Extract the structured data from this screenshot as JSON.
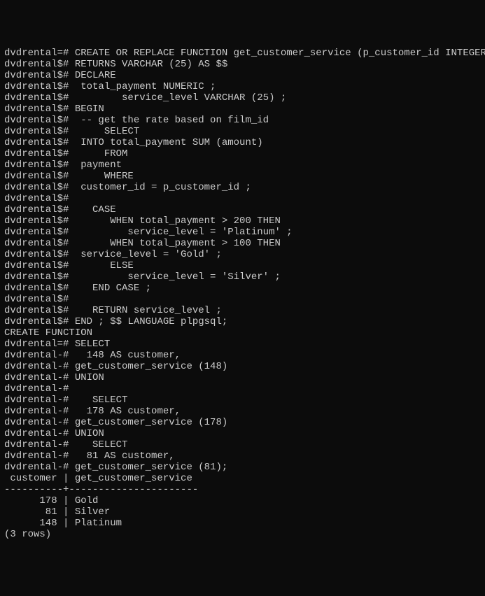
{
  "lines": [
    {
      "prompt": "dvdrental=#",
      "text": " CREATE OR REPLACE FUNCTION get_customer_service (p_customer_id INTEGER)"
    },
    {
      "prompt": "dvdrental$#",
      "text": " RETURNS VARCHAR (25) AS $$"
    },
    {
      "prompt": "dvdrental$#",
      "text": " DECLARE"
    },
    {
      "prompt": "dvdrental$#",
      "text": "  total_payment NUMERIC ;"
    },
    {
      "prompt": "dvdrental$#",
      "text": "         service_level VARCHAR (25) ;"
    },
    {
      "prompt": "dvdrental$#",
      "text": " BEGIN"
    },
    {
      "prompt": "dvdrental$#",
      "text": "  -- get the rate based on film_id"
    },
    {
      "prompt": "dvdrental$#",
      "text": "      SELECT"
    },
    {
      "prompt": "dvdrental$#",
      "text": "  INTO total_payment SUM (amount)"
    },
    {
      "prompt": "dvdrental$#",
      "text": "      FROM"
    },
    {
      "prompt": "dvdrental$#",
      "text": "  payment"
    },
    {
      "prompt": "dvdrental$#",
      "text": "      WHERE"
    },
    {
      "prompt": "dvdrental$#",
      "text": "  customer_id = p_customer_id ;"
    },
    {
      "prompt": "dvdrental$#",
      "text": ""
    },
    {
      "prompt": "dvdrental$#",
      "text": "    CASE"
    },
    {
      "prompt": "dvdrental$#",
      "text": "       WHEN total_payment > 200 THEN"
    },
    {
      "prompt": "dvdrental$#",
      "text": "          service_level = 'Platinum' ;"
    },
    {
      "prompt": "dvdrental$#",
      "text": "       WHEN total_payment > 100 THEN"
    },
    {
      "prompt": "dvdrental$#",
      "text": "  service_level = 'Gold' ;"
    },
    {
      "prompt": "dvdrental$#",
      "text": "       ELSE"
    },
    {
      "prompt": "dvdrental$#",
      "text": "          service_level = 'Silver' ;"
    },
    {
      "prompt": "dvdrental$#",
      "text": "    END CASE ;"
    },
    {
      "prompt": "dvdrental$#",
      "text": ""
    },
    {
      "prompt": "dvdrental$#",
      "text": "    RETURN service_level ;"
    },
    {
      "prompt": "dvdrental$#",
      "text": " END ; $$ LANGUAGE plpgsql;"
    },
    {
      "prompt": "",
      "text": "CREATE FUNCTION"
    },
    {
      "prompt": "dvdrental=#",
      "text": " SELECT"
    },
    {
      "prompt": "dvdrental-#",
      "text": "   148 AS customer,"
    },
    {
      "prompt": "dvdrental-#",
      "text": " get_customer_service (148)"
    },
    {
      "prompt": "dvdrental-#",
      "text": " UNION"
    },
    {
      "prompt": "dvdrental-#",
      "text": ""
    },
    {
      "prompt": "dvdrental-#",
      "text": "    SELECT"
    },
    {
      "prompt": "dvdrental-#",
      "text": "   178 AS customer,"
    },
    {
      "prompt": "dvdrental-#",
      "text": " get_customer_service (178)"
    },
    {
      "prompt": "dvdrental-#",
      "text": " UNION"
    },
    {
      "prompt": "dvdrental-#",
      "text": "    SELECT"
    },
    {
      "prompt": "dvdrental-#",
      "text": "   81 AS customer,"
    },
    {
      "prompt": "dvdrental-#",
      "text": " get_customer_service (81);"
    },
    {
      "prompt": "",
      "text": " customer | get_customer_service"
    },
    {
      "prompt": "",
      "text": "----------+----------------------"
    },
    {
      "prompt": "",
      "text": "      178 | Gold"
    },
    {
      "prompt": "",
      "text": "       81 | Silver"
    },
    {
      "prompt": "",
      "text": "      148 | Platinum"
    },
    {
      "prompt": "",
      "text": "(3 rows)"
    }
  ]
}
